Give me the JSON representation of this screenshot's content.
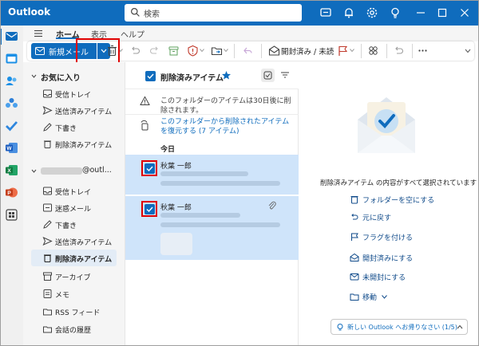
{
  "app": {
    "title": "Outlook"
  },
  "search": {
    "placeholder": "検索"
  },
  "ribbon": {
    "tabs": [
      {
        "label": "ホーム",
        "active": true
      },
      {
        "label": "表示"
      },
      {
        "label": "ヘルプ"
      }
    ],
    "new_mail_label": "新規メール",
    "mark_read_label": "開封済み / 未読"
  },
  "folders": {
    "favorites_header": "お気に入り",
    "favorites": [
      {
        "label": "受信トレイ",
        "icon": "inbox-icon"
      },
      {
        "label": "送信済みアイテム",
        "icon": "send-icon"
      },
      {
        "label": "下書き",
        "icon": "draft-icon"
      },
      {
        "label": "削除済みアイテム",
        "icon": "trash-icon"
      }
    ],
    "account_header": "@outl...",
    "account_items": [
      {
        "label": "受信トレイ",
        "icon": "inbox-icon"
      },
      {
        "label": "迷惑メール",
        "icon": "junk-icon"
      },
      {
        "label": "下書き",
        "icon": "draft-icon"
      },
      {
        "label": "送信済みアイテム",
        "icon": "send-icon"
      },
      {
        "label": "削除済みアイテム",
        "icon": "trash-icon",
        "active": true
      },
      {
        "label": "アーカイブ",
        "icon": "archive-icon"
      },
      {
        "label": "メモ",
        "icon": "note-icon"
      },
      {
        "label": "RSS フィード",
        "icon": "rss-icon"
      },
      {
        "label": "会話の履歴",
        "icon": "history-icon"
      }
    ]
  },
  "list": {
    "title": "削除済みアイテム",
    "info_notice": "このフォルダーのアイテムは30日後に削除されます。",
    "restore_link": "このフォルダーから削除されたアイテムを復元する (7 アイテム)",
    "today_label": "今日",
    "messages": [
      {
        "sender": "秋葉 一郎"
      },
      {
        "sender": "秋葉 一郎"
      }
    ]
  },
  "reading": {
    "selected_text": "削除済みアイテム の内容がすべて選択されています",
    "actions": [
      {
        "label": "フォルダーを空にする",
        "icon": "trash-icon"
      },
      {
        "label": "元に戻す",
        "icon": "undo-icon"
      },
      {
        "label": "フラグを付ける",
        "icon": "flag-icon"
      },
      {
        "label": "開封済みにする",
        "icon": "mail-open-icon"
      },
      {
        "label": "未開封にする",
        "icon": "mail-icon"
      },
      {
        "label": "移動",
        "icon": "move-icon"
      }
    ],
    "promo_text": "新しい Outlook へお帰りなさい (1/5)"
  },
  "colors": {
    "accent": "#0f6cbd",
    "highlight": "#e00000",
    "selected": "#cfe4fa"
  }
}
